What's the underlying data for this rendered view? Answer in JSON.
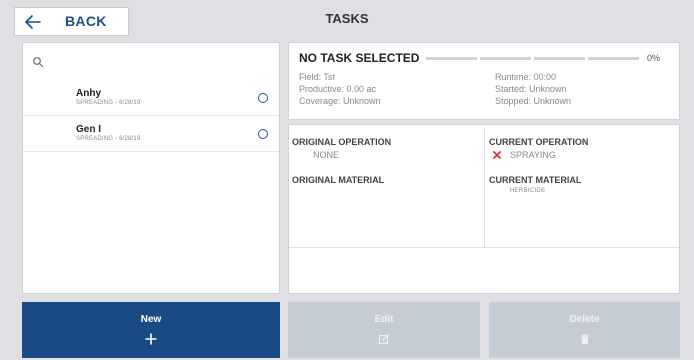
{
  "header": {
    "back_label": "BACK",
    "title": "TASKS"
  },
  "task_list": {
    "items": [
      {
        "name": "Anhy",
        "subtitle": "SPREADING - 6/28/19"
      },
      {
        "name": "Gen I",
        "subtitle": "SPREADING - 6/28/19"
      }
    ]
  },
  "status": {
    "title": "NO TASK SELECTED",
    "progress_percent": 0,
    "progress_label": "0%",
    "field": "Field: Tst",
    "productive": "Productive: 0.00 ac",
    "coverage": "Coverage: Unknown",
    "runtime": "Runtime: 00:00",
    "started": "Started: Unknown",
    "stopped": "Stopped: Unknown"
  },
  "operations": {
    "original_operation_label": "ORIGINAL OPERATION",
    "original_operation_value": "NONE",
    "original_material_label": "ORIGINAL MATERIAL",
    "current_operation_label": "CURRENT OPERATION",
    "current_operation_value": "SPRAYING",
    "current_material_label": "CURRENT MATERIAL",
    "current_material_value": "HERBICIDE"
  },
  "actions": {
    "new_label": "New",
    "edit_label": "Edit",
    "delete_label": "Delete"
  },
  "colors": {
    "accent": "#1a4a83",
    "disabled": "#c6ccd6",
    "error_red": "#d9323a"
  }
}
